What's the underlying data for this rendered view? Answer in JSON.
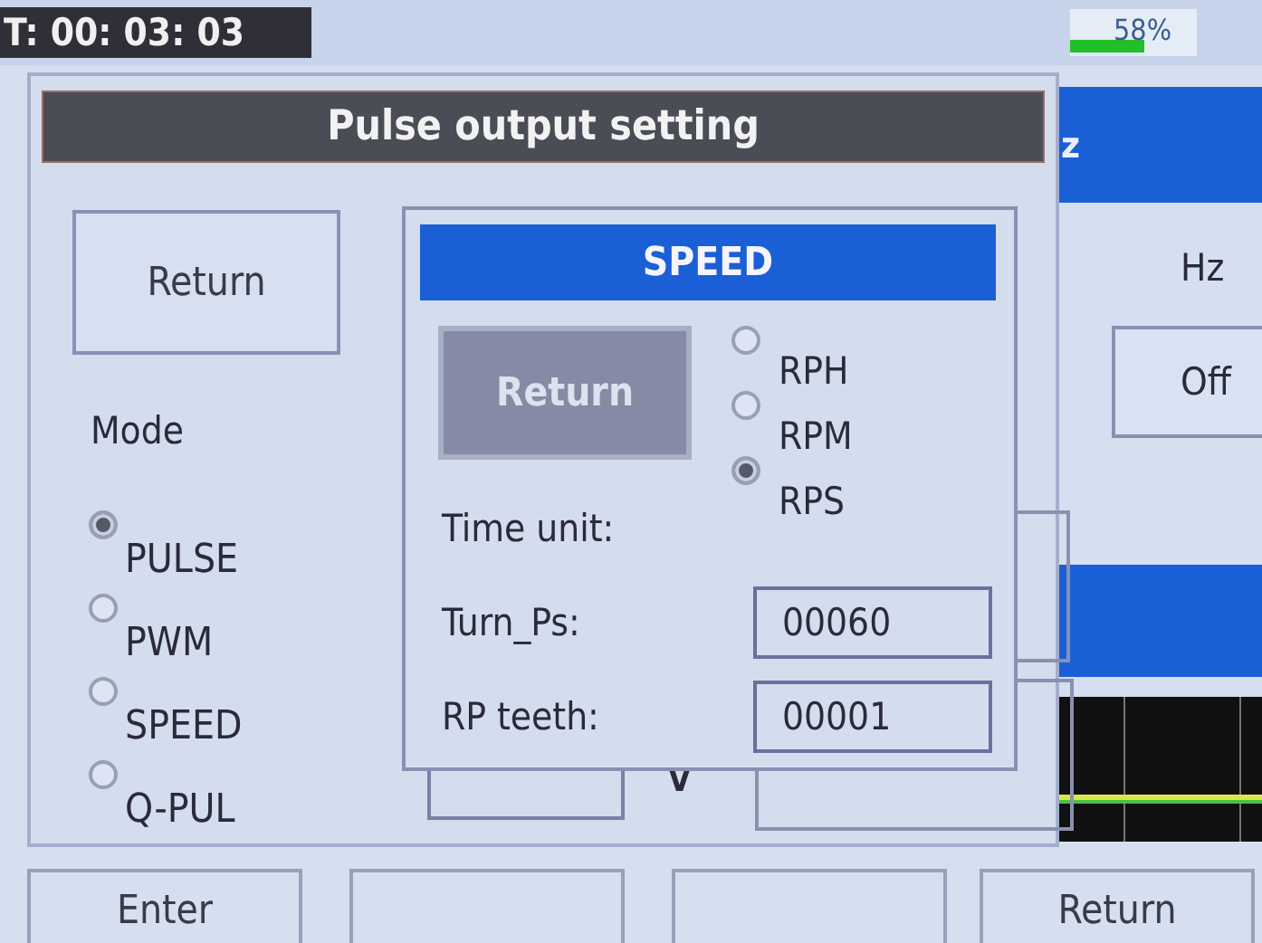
{
  "status_bar": {
    "timer": "T: 00: 03: 03",
    "battery": {
      "level": 0.58,
      "reading": "58%"
    }
  },
  "background": {
    "title_fragment": "z",
    "unit": "Hz",
    "off_button": "Off",
    "voltage_unit": "V"
  },
  "dialog": {
    "title": "Pulse output setting",
    "return_button": "Return",
    "mode_label": "Mode",
    "modes": [
      {
        "label": "PULSE",
        "selected": true
      },
      {
        "label": "PWM",
        "selected": false
      },
      {
        "label": "SPEED",
        "selected": false
      },
      {
        "label": "Q-PUL",
        "selected": false
      }
    ]
  },
  "speed_dialog": {
    "title": "SPEED",
    "return_button": {
      "label": "Return",
      "focused": true
    },
    "time_unit_label": "Time unit:",
    "units": [
      {
        "label": "RPH",
        "selected": false
      },
      {
        "label": "RPM",
        "selected": false
      },
      {
        "label": "RPS",
        "selected": true
      }
    ],
    "fields": [
      {
        "label": "Turn_Ps:",
        "value": "00060"
      },
      {
        "label": "RP teeth:",
        "value": "00001"
      }
    ]
  },
  "softkeys": [
    {
      "kind": "labeled",
      "label": "Enter"
    },
    {
      "kind": "blank"
    },
    {
      "kind": "blank"
    },
    {
      "kind": "labeled",
      "label": "Return"
    }
  ]
}
